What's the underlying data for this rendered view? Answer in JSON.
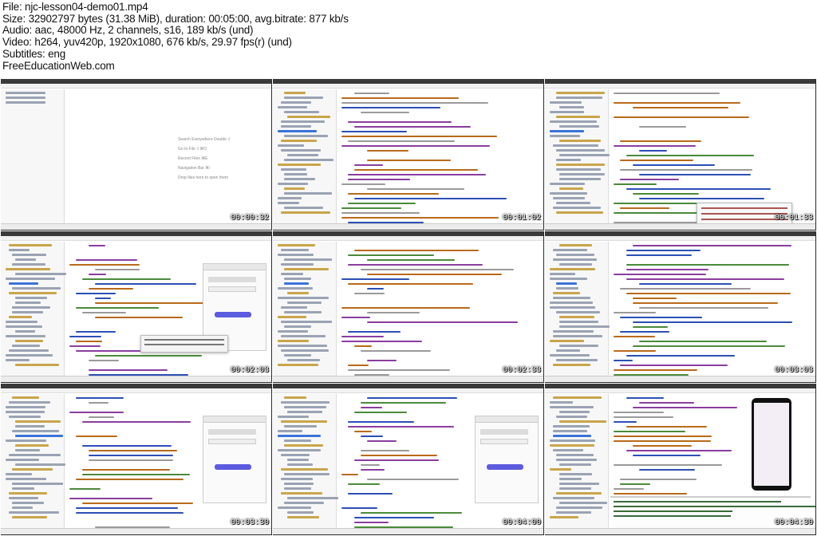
{
  "header": {
    "file": "File: njc-lesson04-demo01.mp4",
    "size": "Size: 32902797 bytes (31.38 MiB), duration: 00:05:00, avg.bitrate: 877 kb/s",
    "audio": "Audio: aac, 48000 Hz, 2 channels, s16, 189 kb/s (und)",
    "video": "Video: h264, yuv420p, 1920x1080, 676 kb/s, 29.97 fps(r) (und)",
    "subtitles": "Subtitles: eng",
    "watermark": "FreeEducationWeb.com"
  },
  "thumbnails": [
    {
      "timestamp": "00:00:32",
      "kind": "welcome"
    },
    {
      "timestamp": "00:01:02",
      "kind": "code"
    },
    {
      "timestamp": "00:01:33",
      "kind": "code-tooltip"
    },
    {
      "timestamp": "00:02:03",
      "kind": "preview-popup"
    },
    {
      "timestamp": "00:02:33",
      "kind": "manifest"
    },
    {
      "timestamp": "00:03:03",
      "kind": "manifest2"
    },
    {
      "timestamp": "00:03:30",
      "kind": "preview"
    },
    {
      "timestamp": "00:04:00",
      "kind": "preview"
    },
    {
      "timestamp": "00:04:30",
      "kind": "emulator"
    }
  ],
  "welcome_items": [
    "Search Everywhere Double ⇧",
    "Go to File ⇧⌘O",
    "Recent Files ⌘E",
    "Navigation Bar ⌘↑",
    "Drop files here to open them"
  ],
  "colors": {
    "code_purple": "#8a3d9e",
    "code_blue": "#2b4fb5",
    "code_green": "#4a8a3a",
    "code_orange": "#b86a1a",
    "code_gray": "#9a9a9a",
    "folder_yellow": "#c9a54b",
    "selection_blue": "#3b73d9"
  }
}
